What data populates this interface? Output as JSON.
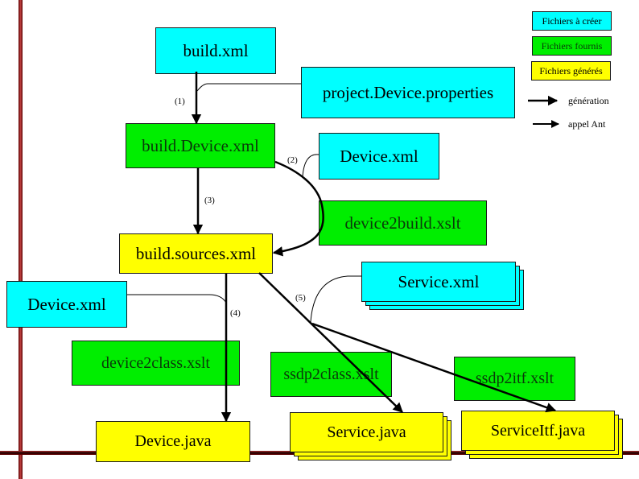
{
  "legend": {
    "to_create": "Fichiers à créer",
    "provided": "Fichiers fournis",
    "generated": "Fichiers générés",
    "generation": "génération",
    "ant_call": "appel Ant"
  },
  "colors": {
    "to_create": "#00ffff",
    "provided": "#00ee00",
    "generated": "#ffff00",
    "frame": "#8b0000"
  },
  "nodes": {
    "build_xml": "build.xml",
    "project_properties": "project.Device.properties",
    "build_device_xml": "build.Device.xml",
    "device_xml_top": "Device.xml",
    "device2build_xslt": "device2build.xslt",
    "build_sources_xml": "build.sources.xml",
    "service_xml": "Service.xml",
    "device_xml_left": "Device.xml",
    "device2class_xslt": "device2class.xslt",
    "ssdp2class_xslt": "ssdp2class.xslt",
    "ssdp2itf_xslt": "ssdp2itf.xslt",
    "device_java": "Device.java",
    "service_java": "Service.java",
    "serviceitf_java": "ServiceItf.java"
  },
  "steps": {
    "s1": "(1)",
    "s2": "(2)",
    "s3": "(3)",
    "s4": "(4)",
    "s5": "(5)"
  }
}
